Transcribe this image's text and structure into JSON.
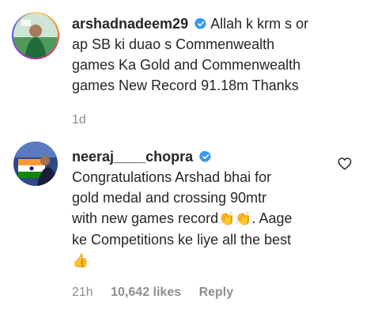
{
  "comments": [
    {
      "username": "arshadnadeem29",
      "text": "Allah k krm s or ap SB ki duao s Commenwealth games Ka Gold and Commenwealth games New Record 91.18m Thanks",
      "lines": [
        "Allah k krm s or",
        "ap SB ki duao s Commenwealth",
        "games Ka Gold and Commenwealth",
        "games New Record 91.18m Thanks"
      ],
      "time": "1d",
      "verified": true
    },
    {
      "username": "neeraj____chopra",
      "lines": [
        "Congratulations Arshad bhai for",
        "gold medal and crossing 90mtr",
        "with new games record",
        ". Aage",
        "ke Competitions ke liye all the best"
      ],
      "emoji_clap": "👏👏",
      "emoji_thumbs": "👍",
      "time": "21h",
      "likes": "10,642 likes",
      "reply": "Reply",
      "verified": true
    }
  ],
  "colors": {
    "verified": "#3897f0",
    "muted": "#8e8e8e",
    "text": "#262626"
  },
  "icons": {
    "verified": "verified-badge-icon",
    "like": "heart-outline-icon"
  }
}
